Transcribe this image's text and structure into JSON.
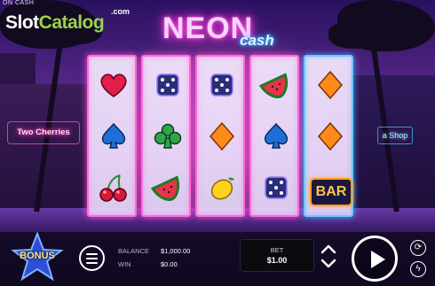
{
  "header": {
    "corner_text": "ON CASH",
    "site_logo": {
      "part1": "Slot",
      "part2": "Catalog",
      "suffix": ".com"
    },
    "game_title": {
      "main": "NEON",
      "sub": "cash"
    }
  },
  "scene": {
    "signs": {
      "left": "Two Cherries",
      "right": "a Shop"
    }
  },
  "reels": [
    {
      "frame": "pink",
      "symbols": [
        "heart-icon",
        "spade-icon",
        "cherries-icon"
      ]
    },
    {
      "frame": "pink",
      "symbols": [
        "dice-icon",
        "club-icon",
        "watermelon-icon"
      ]
    },
    {
      "frame": "pink",
      "symbols": [
        "dice-icon",
        "diamond-icon",
        "lemon-icon"
      ]
    },
    {
      "frame": "pink",
      "symbols": [
        "watermelon-icon",
        "spade-icon",
        "dice-icon"
      ]
    },
    {
      "frame": "blue",
      "symbols": [
        "diamond-icon",
        "diamond-icon",
        "bar-symbol"
      ]
    }
  ],
  "bar_symbol_label": "BAR",
  "controls": {
    "bonus_label": "BONUS",
    "balance_label": "BALANCE",
    "balance_value": "$1,000.00",
    "win_label": "WIN",
    "win_value": "$0.00",
    "bet_label": "BET",
    "bet_value": "$1.00"
  },
  "colors": {
    "neon_pink": "#ff4bd0",
    "neon_blue": "#4aa8ff",
    "logo_green": "#9ad24a",
    "bonus_yellow": "#ffe27a"
  }
}
